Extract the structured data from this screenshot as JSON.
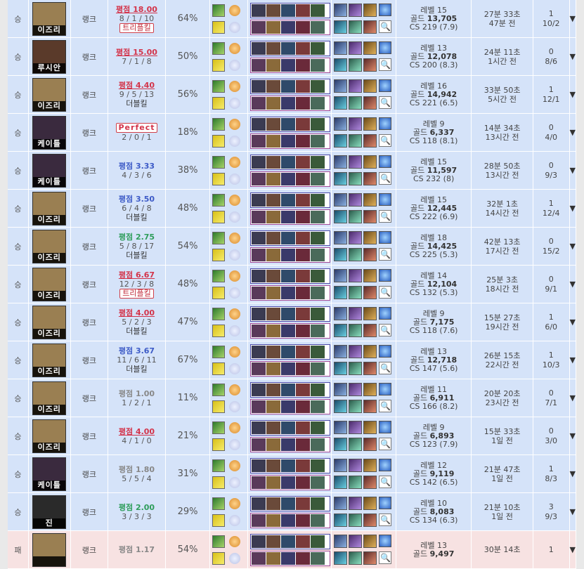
{
  "labels": {
    "type": "랭크",
    "level_prefix": "레벨",
    "gold_prefix": "골드",
    "cs_prefix": "CS",
    "expand": "▼",
    "search": "🔍"
  },
  "rows": [
    {
      "result": "승",
      "champ": "이즈리",
      "type": "랭크",
      "score": "평점 18.00",
      "score_style": "red",
      "kda": "8 / 1 / 10",
      "badge": "트리플킬",
      "badge_style": "boxed",
      "ratio": "64%",
      "level": "레벨 15",
      "gold_label": "골드",
      "gold": "13,705",
      "cs": "CS 219 (7.9)",
      "duration": "27분 33초",
      "ago": "47분 전",
      "kills": "1",
      "kp": "10/2",
      "face": "#9a7f52"
    },
    {
      "result": "승",
      "champ": "루시안",
      "type": "랭크",
      "score": "평점 15.00",
      "score_style": "red",
      "kda": "7 / 1 / 8",
      "badge": "",
      "badge_style": "",
      "ratio": "50%",
      "level": "레벨 13",
      "gold_label": "골드",
      "gold": "12,078",
      "cs": "CS 200 (8.3)",
      "duration": "24분 11초",
      "ago": "1시간 전",
      "kills": "0",
      "kp": "8/6",
      "face": "#5a3a2a"
    },
    {
      "result": "승",
      "champ": "이즈리",
      "type": "랭크",
      "score": "평점 4.40",
      "score_style": "red",
      "kda": "9 / 5 / 13",
      "badge": "더블킬",
      "badge_style": "",
      "ratio": "56%",
      "level": "레벨 16",
      "gold_label": "골드",
      "gold": "14,942",
      "cs": "CS 221 (6.5)",
      "duration": "33분 50초",
      "ago": "5시간 전",
      "kills": "1",
      "kp": "12/1",
      "face": "#9a7f52"
    },
    {
      "result": "승",
      "champ": "케이틀",
      "type": "랭크",
      "score": "Perfect",
      "score_style": "perfect",
      "kda": "2 / 0 / 1",
      "badge": "",
      "badge_style": "",
      "ratio": "18%",
      "level": "레벨 9",
      "gold_label": "골드",
      "gold": "6,337",
      "cs": "CS 118 (8.1)",
      "duration": "14분 34초",
      "ago": "13시간 전",
      "kills": "0",
      "kp": "4/0",
      "face": "#3a2a3e"
    },
    {
      "result": "승",
      "champ": "케이틀",
      "type": "랭크",
      "score": "평점 3.33",
      "score_style": "blue",
      "kda": "4 / 3 / 6",
      "badge": "",
      "badge_style": "",
      "ratio": "38%",
      "level": "레벨 15",
      "gold_label": "골드",
      "gold": "11,597",
      "cs": "CS 232 (8)",
      "duration": "28분 50초",
      "ago": "13시간 전",
      "kills": "0",
      "kp": "9/3",
      "face": "#3a2a3e"
    },
    {
      "result": "승",
      "champ": "이즈리",
      "type": "랭크",
      "score": "평점 3.50",
      "score_style": "blue",
      "kda": "6 / 4 / 8",
      "badge": "더블킬",
      "badge_style": "",
      "ratio": "48%",
      "level": "레벨 15",
      "gold_label": "골드",
      "gold": "12,445",
      "cs": "CS 222 (6.9)",
      "duration": "32분 1초",
      "ago": "14시간 전",
      "kills": "1",
      "kp": "12/4",
      "face": "#9a7f52"
    },
    {
      "result": "승",
      "champ": "이즈리",
      "type": "랭크",
      "score": "평점 2.75",
      "score_style": "green",
      "kda": "5 / 8 / 17",
      "badge": "더블킬",
      "badge_style": "",
      "ratio": "54%",
      "level": "레벨 18",
      "gold_label": "골드",
      "gold": "14,425",
      "cs": "CS 225 (5.3)",
      "duration": "42분 13초",
      "ago": "17시간 전",
      "kills": "0",
      "kp": "15/2",
      "face": "#9a7f52"
    },
    {
      "result": "승",
      "champ": "이즈리",
      "type": "랭크",
      "score": "평점 6.67",
      "score_style": "red",
      "kda": "12 / 3 / 8",
      "badge": "트리플킬",
      "badge_style": "boxed",
      "ratio": "48%",
      "level": "레벨 14",
      "gold_label": "골드",
      "gold": "12,104",
      "cs": "CS 132 (5.3)",
      "duration": "25분 3초",
      "ago": "18시간 전",
      "kills": "0",
      "kp": "9/1",
      "face": "#9a7f52"
    },
    {
      "result": "승",
      "champ": "이즈리",
      "type": "랭크",
      "score": "평점 4.00",
      "score_style": "red",
      "kda": "5 / 2 / 3",
      "badge": "더블킬",
      "badge_style": "",
      "ratio": "47%",
      "level": "레벨 9",
      "gold_label": "골드",
      "gold": "7,175",
      "cs": "CS 118 (7.6)",
      "duration": "15분 27초",
      "ago": "19시간 전",
      "kills": "1",
      "kp": "6/0",
      "face": "#9a7f52"
    },
    {
      "result": "승",
      "champ": "이즈리",
      "type": "랭크",
      "score": "평점 3.67",
      "score_style": "blue",
      "kda": "11 / 6 / 11",
      "badge": "더블킬",
      "badge_style": "",
      "ratio": "67%",
      "level": "레벨 13",
      "gold_label": "골드",
      "gold": "12,718",
      "cs": "CS 147 (5.6)",
      "duration": "26분 15초",
      "ago": "22시간 전",
      "kills": "1",
      "kp": "10/3",
      "face": "#9a7f52"
    },
    {
      "result": "승",
      "champ": "이즈리",
      "type": "랭크",
      "score": "평점 1.00",
      "score_style": "gray",
      "kda": "1 / 2 / 1",
      "badge": "",
      "badge_style": "",
      "ratio": "11%",
      "level": "레벨 11",
      "gold_label": "골드",
      "gold": "6,911",
      "cs": "CS 166 (8.2)",
      "duration": "20분 20초",
      "ago": "23시간 전",
      "kills": "0",
      "kp": "7/1",
      "face": "#9a7f52"
    },
    {
      "result": "승",
      "champ": "이즈리",
      "type": "랭크",
      "score": "평점 4.00",
      "score_style": "red",
      "kda": "4 / 1 / 0",
      "badge": "",
      "badge_style": "",
      "ratio": "21%",
      "level": "레벨 9",
      "gold_label": "골드",
      "gold": "6,893",
      "cs": "CS 123 (7.9)",
      "duration": "15분 33초",
      "ago": "1일 전",
      "kills": "0",
      "kp": "3/0",
      "face": "#9a7f52"
    },
    {
      "result": "승",
      "champ": "케이틀",
      "type": "랭크",
      "score": "평점 1.80",
      "score_style": "gray",
      "kda": "5 / 5 / 4",
      "badge": "",
      "badge_style": "",
      "ratio": "31%",
      "level": "레벨 12",
      "gold_label": "골드",
      "gold": "9,119",
      "cs": "CS 142 (6.5)",
      "duration": "21분 47초",
      "ago": "1일 전",
      "kills": "1",
      "kp": "8/3",
      "face": "#3a2a3e"
    },
    {
      "result": "승",
      "champ": "진",
      "type": "랭크",
      "score": "평점 2.00",
      "score_style": "green",
      "kda": "3 / 3 / 3",
      "badge": "",
      "badge_style": "",
      "ratio": "29%",
      "level": "레벨 10",
      "gold_label": "골드",
      "gold": "8,083",
      "cs": "CS 134 (6.3)",
      "duration": "21분 10초",
      "ago": "1일 전",
      "kills": "3",
      "kp": "9/3",
      "face": "#2a2a2a"
    },
    {
      "result": "패",
      "champ": "",
      "type": "랭크",
      "score": "평점 1.17",
      "score_style": "gray",
      "kda": "",
      "badge": "",
      "badge_style": "",
      "ratio": "54%",
      "level": "레벨 13",
      "gold_label": "골드",
      "gold": "9,497",
      "cs": "",
      "duration": "30분 14초",
      "ago": "",
      "kills": "1",
      "kp": "",
      "face": "#9a7f52",
      "lose": true
    }
  ]
}
